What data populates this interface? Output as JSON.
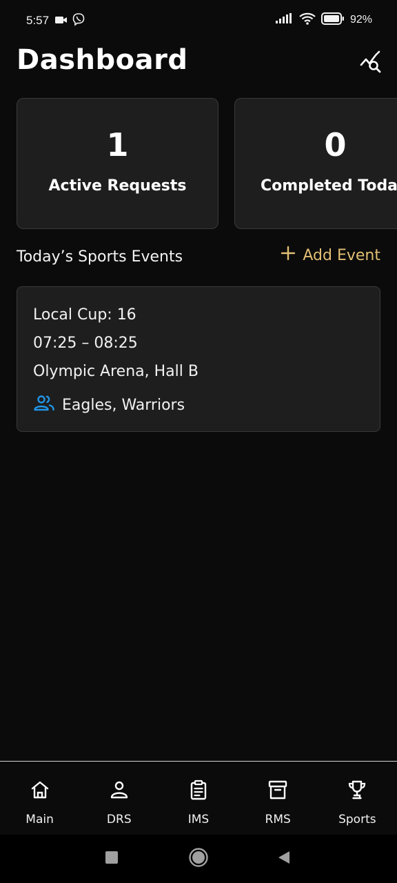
{
  "status_bar": {
    "time": "5:57",
    "battery": "92%",
    "icons": [
      "video-icon",
      "viber-icon",
      "signal-icon",
      "wifi-icon",
      "battery-icon"
    ]
  },
  "header": {
    "title": "Dashboard",
    "action_icon": "chart-search-icon"
  },
  "stats": [
    {
      "value": "1",
      "label": "Active Requests"
    },
    {
      "value": "0",
      "label": "Completed Today"
    }
  ],
  "events_section": {
    "title": "Today’s Sports Events",
    "add_label": "Add Event",
    "accent_color": "#e2bf74"
  },
  "events": [
    {
      "title": "Local Cup: 16",
      "time": "07:25 – 08:25",
      "venue": "Olympic Arena, Hall B",
      "teams": "Eagles, Warriors",
      "teams_icon": "people-icon",
      "teams_icon_color": "#2196e8"
    }
  ],
  "bottom_nav": [
    {
      "label": "Main",
      "icon": "home-icon"
    },
    {
      "label": "DRS",
      "icon": "person-icon"
    },
    {
      "label": "IMS",
      "icon": "clipboard-icon"
    },
    {
      "label": "RMS",
      "icon": "archive-icon"
    },
    {
      "label": "Sports",
      "icon": "trophy-icon"
    }
  ]
}
